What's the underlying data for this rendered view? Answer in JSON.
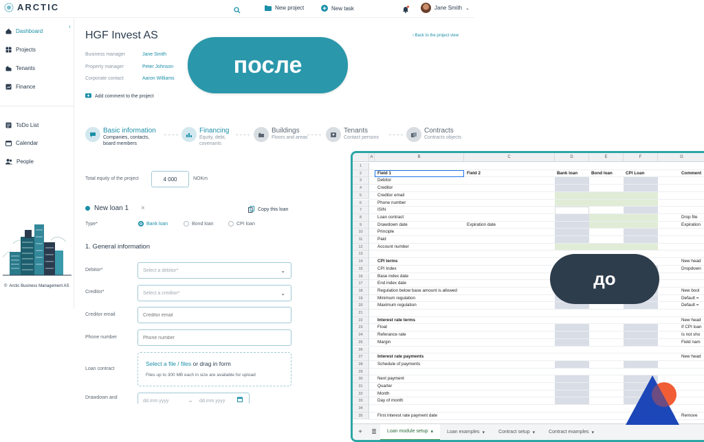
{
  "app": {
    "brand": "ARCTIC"
  },
  "topbar": {
    "new_project": "New project",
    "new_task": "New task",
    "user_name": "Jane Smith"
  },
  "sidebar": {
    "items": [
      {
        "label": "Dashboard",
        "icon": "home-icon"
      },
      {
        "label": "Projects",
        "icon": "grid-icon"
      },
      {
        "label": "Tenants",
        "icon": "building-icon"
      },
      {
        "label": "Finance",
        "icon": "finance-icon"
      },
      {
        "label": "ToDo List",
        "icon": "list-icon"
      },
      {
        "label": "Calendar",
        "icon": "calendar-icon"
      },
      {
        "label": "People",
        "icon": "people-icon"
      }
    ],
    "copyright": "Arctic Business Management AS"
  },
  "project": {
    "title": "HGF Invest AS",
    "back_link": "Back to the project view",
    "business_manager_label": "Business manager",
    "business_manager": "Jane Smith",
    "property_manager_label": "Property manager",
    "property_manager": "Peter Johnson",
    "corporate_contact_label": "Corporate contact",
    "corporate_contact": "Aaron Williams",
    "add_comment": "Add comment to the project"
  },
  "steps": [
    {
      "title": "Basic information",
      "sub": "Companies, contacts, board members"
    },
    {
      "title": "Financing",
      "sub": "Equity, debt, covenants"
    },
    {
      "title": "Buildings",
      "sub": "Floors and areas"
    },
    {
      "title": "Tenants",
      "sub": "Contact persons"
    },
    {
      "title": "Contracts",
      "sub": "Contracts objects"
    }
  ],
  "form": {
    "equity_label": "Total equity of the project",
    "equity_value": "4 000",
    "equity_unit": "NOKm",
    "loan_title": "New loan 1",
    "copy_loan": "Copy this loan",
    "type_label": "Type*",
    "types": [
      "Bank loan",
      "Bond loan",
      "CPI loan"
    ],
    "section": "1. General information",
    "debitor_label": "Debitor*",
    "debitor_placeholder": "Select a debitor*",
    "creditor_label": "Creditor*",
    "creditor_placeholder": "Select a creditor*",
    "creditor_email_label": "Creditor email",
    "creditor_email_placeholder": "Creditor email",
    "phone_label": "Phone number",
    "phone_placeholder": "Phone number",
    "loan_contract_label": "Loan contract",
    "upload_link": "Select a file / files",
    "upload_text": " or drag in form",
    "upload_hint": "Files up to 300 MB each in size are available for upload",
    "drawdown_label": "Drawdown and",
    "date_placeholder": "dd.mm.yyyy"
  },
  "badges": {
    "after": "после",
    "before": "до"
  },
  "badge_colors": {
    "after": "#2a97ab",
    "before": "#2e3d4c",
    "accent": "#1a8ea8"
  },
  "sheet": {
    "columns": [
      "A",
      "B",
      "C",
      "D",
      "E",
      "F",
      "G"
    ],
    "header_row": {
      "field1": "Field 1",
      "field2": "Field 2",
      "bank": "Bank loan",
      "bond": "Bond loan",
      "cpi": "CPI Loan",
      "comment": "Comment"
    },
    "rows": [
      {
        "n": "1",
        "b": "",
        "c": "",
        "h": ""
      },
      {
        "n": "2",
        "b": "",
        "c": "",
        "h": ""
      },
      {
        "n": "3",
        "b": "Debitor",
        "c": "",
        "h": ""
      },
      {
        "n": "4",
        "b": "Creditor",
        "c": "",
        "h": ""
      },
      {
        "n": "5",
        "b": "Creditor email",
        "c": "",
        "h": ""
      },
      {
        "n": "6",
        "b": "Phone number",
        "c": "",
        "h": ""
      },
      {
        "n": "7",
        "b": "ISIN",
        "c": "",
        "h": ""
      },
      {
        "n": "8",
        "b": "Loan contract",
        "c": "",
        "h": "Drop file"
      },
      {
        "n": "9",
        "b": "Drawdown date",
        "c": "Expiration date",
        "h": "Expiration"
      },
      {
        "n": "10",
        "b": "Principle",
        "c": "",
        "h": ""
      },
      {
        "n": "11",
        "b": "Paid",
        "c": "",
        "h": ""
      },
      {
        "n": "12",
        "b": "Account number",
        "c": "",
        "h": ""
      },
      {
        "n": "13",
        "b": "",
        "c": "",
        "h": ""
      },
      {
        "n": "14",
        "b": "CPI terms",
        "c": "",
        "h": "New head"
      },
      {
        "n": "15",
        "b": "CPI Index",
        "c": "",
        "h": "Dropdown"
      },
      {
        "n": "16",
        "b": "Base index date",
        "c": "",
        "h": ""
      },
      {
        "n": "17",
        "b": "End index date",
        "c": "",
        "h": ""
      },
      {
        "n": "18",
        "b": "Regulation below base amount is allowed",
        "c": "",
        "h": "New bool"
      },
      {
        "n": "19",
        "b": "Minimum regulation",
        "c": "",
        "h": "Default ="
      },
      {
        "n": "20",
        "b": "Maximum regulation",
        "c": "",
        "h": "Default ="
      },
      {
        "n": "21",
        "b": "",
        "c": "",
        "h": ""
      },
      {
        "n": "22",
        "b": "Interest rate terms",
        "c": "",
        "h": "New head"
      },
      {
        "n": "23",
        "b": "Float",
        "c": "",
        "h": "If CPI loan"
      },
      {
        "n": "24",
        "b": "Referance rate",
        "c": "",
        "h": "Is not sho"
      },
      {
        "n": "25",
        "b": "Margin",
        "c": "",
        "h": "Field nam"
      },
      {
        "n": "26",
        "b": "",
        "c": "",
        "h": ""
      },
      {
        "n": "27",
        "b": "Interest rate payments",
        "c": "",
        "h": "New head"
      },
      {
        "n": "28",
        "b": "Schedule of payments",
        "c": "",
        "h": ""
      },
      {
        "n": "29",
        "b": "",
        "c": "",
        "h": ""
      },
      {
        "n": "30",
        "b": "Next payment",
        "c": "",
        "h": ""
      },
      {
        "n": "31",
        "b": "Quarter",
        "c": "",
        "h": ""
      },
      {
        "n": "32",
        "b": "Month",
        "c": "",
        "h": ""
      },
      {
        "n": "33",
        "b": "Day of month",
        "c": "",
        "h": ""
      },
      {
        "n": "34",
        "b": "",
        "c": "",
        "h": ""
      },
      {
        "n": "35",
        "b": "First interest rate payment date",
        "c": "",
        "h": "Remove"
      }
    ],
    "tabs": [
      "Loan module setup",
      "Loan examples",
      "Contract setup",
      "Contract examples"
    ]
  }
}
